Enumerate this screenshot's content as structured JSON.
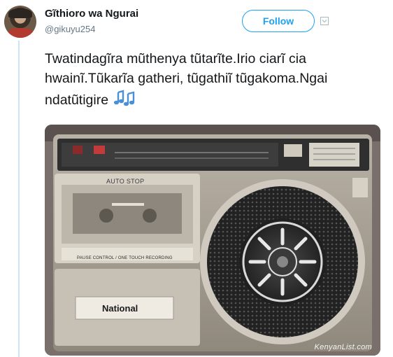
{
  "user": {
    "name": "Gĩthioro wa Ngurai",
    "handle": "@gikuyu254"
  },
  "actions": {
    "follow_label": "Follow",
    "more_icon": "chevron-down-icon"
  },
  "tweet": {
    "text": "Twatindagĩra mũthenya tũtarĩte.Irio ciarĩ cia hwainĩ.Tũkarĩa gatheri, tũgathiĩ tũgakoma.Ngai ndatũtigire",
    "emoji": "music-notes-icon"
  },
  "media": {
    "description_icon": "radio-cassette-photo",
    "auto_stop_label": "AUTO STOP",
    "pause_label": "PAUSE CONTROL / ONE TOUCH RECORDING",
    "brand_label": "National",
    "watermark": "KenyanList.com"
  },
  "colors": {
    "accent": "#1da1f2",
    "thread_line": "#cfe3f3",
    "secondary_text": "#657786"
  }
}
